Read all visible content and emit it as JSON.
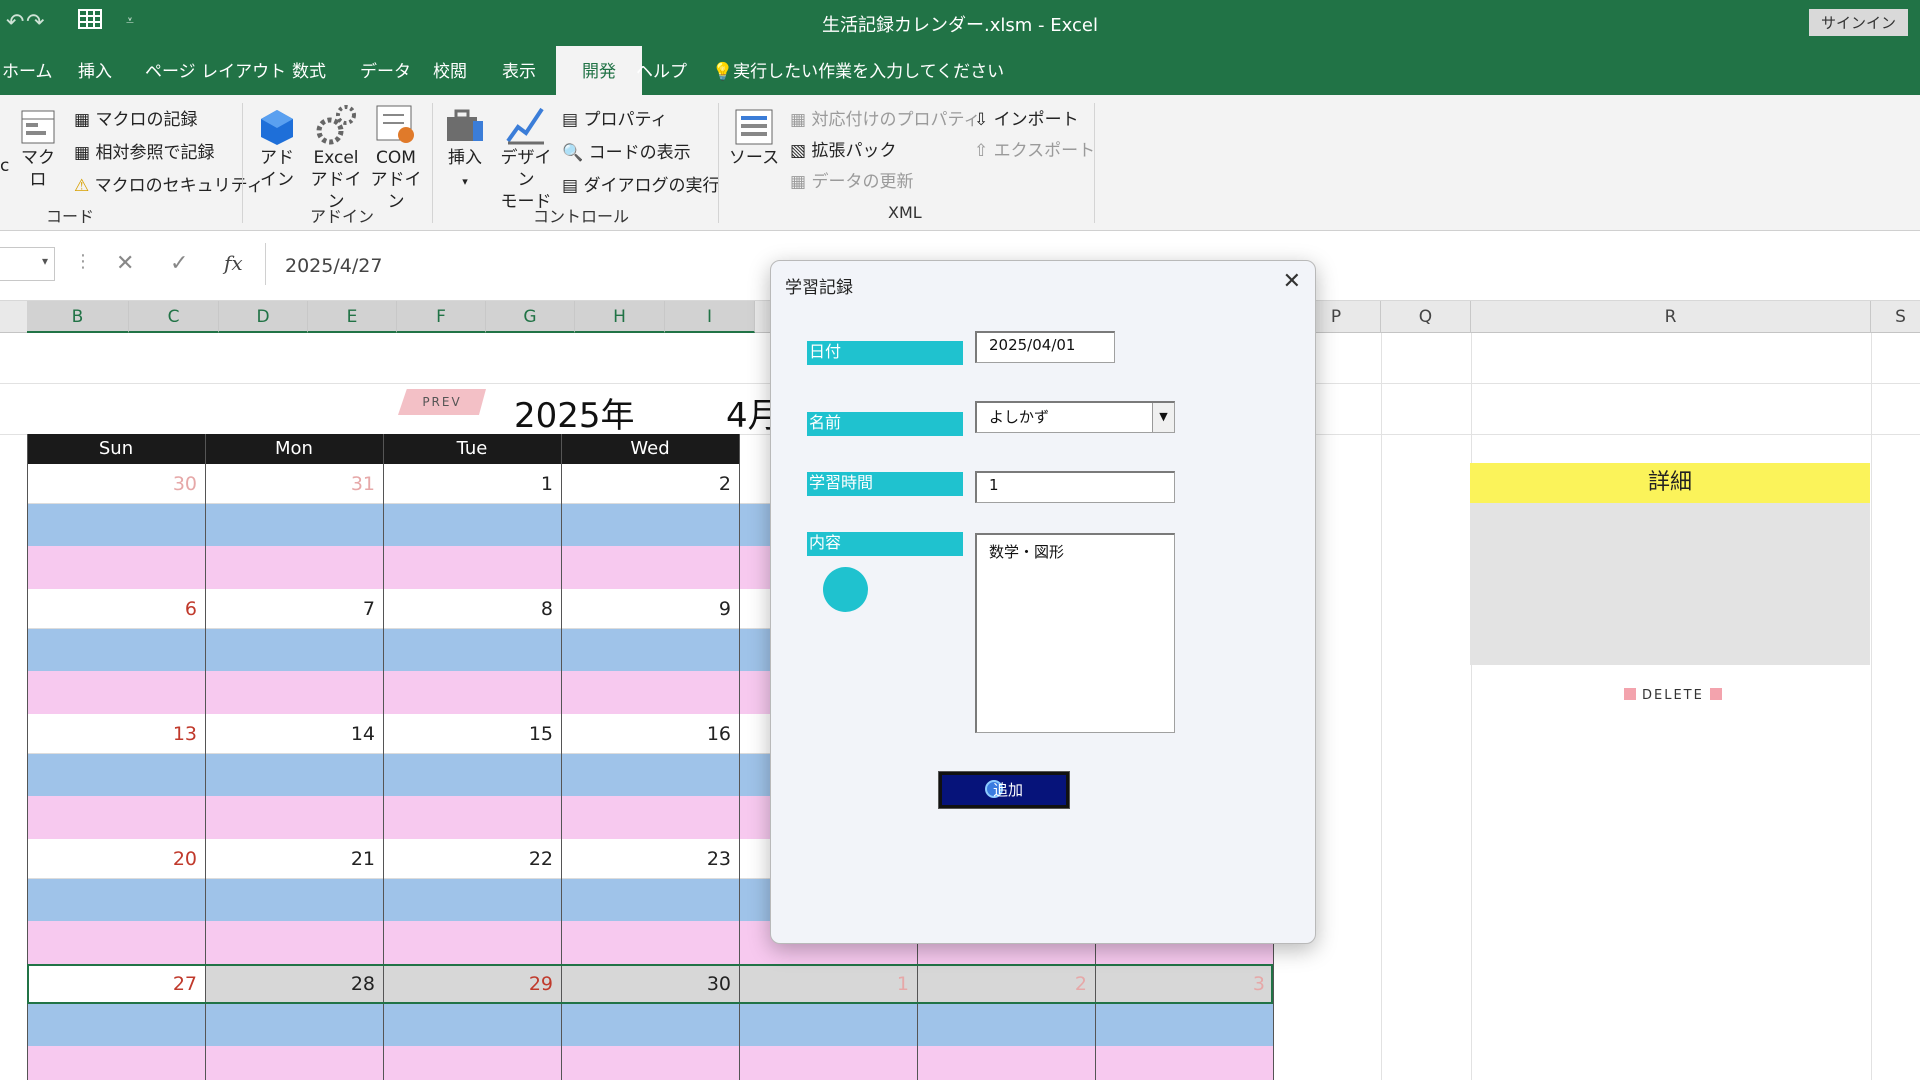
{
  "window": {
    "title": "生活記録カレンダー.xlsm  -  Excel",
    "signin": "サインイン"
  },
  "tabs": [
    "ホーム",
    "挿入",
    "ページ レイアウト",
    "数式",
    "データ",
    "校閲",
    "表示",
    "開発",
    "ヘルプ"
  ],
  "active_tab": "開発",
  "tell_me": "実行したい作業を入力してください",
  "ribbon": {
    "code": {
      "group": "コード",
      "vb_fragment": "c",
      "macro": "マクロ",
      "record": "マクロの記録",
      "relative": "相対参照で記録",
      "security": "マクロのセキュリティ"
    },
    "addins": {
      "group": "アドイン",
      "addin_1": "アド",
      "addin_2": "イン",
      "excel_1": "Excel",
      "excel_2": "アドイン",
      "com_1": "COM",
      "com_2": "アドイン"
    },
    "controls": {
      "group": "コントロール",
      "insert": "挿入",
      "design_1": "デザイン",
      "design_2": "モード",
      "properties": "プロパティ",
      "view_code": "コードの表示",
      "run_dialog": "ダイアログの実行"
    },
    "xml": {
      "group": "XML",
      "source": "ソース",
      "map_properties": "対応付けのプロパティ",
      "expansion": "拡張パック",
      "refresh": "データの更新",
      "import": "インポート",
      "export": "エクスポート"
    }
  },
  "formula_bar": {
    "value": "2025/4/27",
    "fx": "fx"
  },
  "columns": [
    "B",
    "C",
    "D",
    "E",
    "F",
    "G",
    "H",
    "I",
    "P",
    "Q",
    "R",
    "S"
  ],
  "calendar": {
    "prev": "PREV",
    "year": "2025年",
    "month": "4月",
    "weekdays": [
      "Sun",
      "Mon",
      "Tue",
      "Wed"
    ],
    "weeks": [
      [
        "30",
        "31",
        "1",
        "2"
      ],
      [
        "6",
        "7",
        "8",
        "9"
      ],
      [
        "13",
        "14",
        "15",
        "16"
      ],
      [
        "20",
        "21",
        "22",
        "23"
      ],
      [
        "27",
        "28",
        "29",
        "30",
        "1",
        "2",
        "3"
      ]
    ]
  },
  "detail": {
    "title": "詳細",
    "delete": "DELETE"
  },
  "dialog": {
    "title": "学習記録",
    "close": "✕",
    "labels": {
      "date": "日付",
      "name": "名前",
      "time": "学習時間",
      "content": "内容"
    },
    "values": {
      "date": "2025/04/01",
      "name": "よしかず",
      "time": "1",
      "content": "数学・図形"
    },
    "add_button": "追加"
  },
  "colors": {
    "excel_green": "#217346",
    "teal": "#1fc2cf",
    "band_blue": "#9fc3e9",
    "band_pink": "#f7c9ef",
    "detail_yellow": "#fbf35a",
    "sunday_red": "#c0392b"
  }
}
